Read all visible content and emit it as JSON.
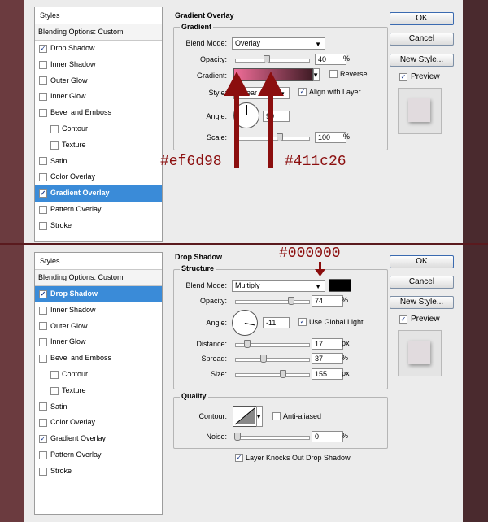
{
  "style_list": {
    "header": "Styles",
    "blending": "Blending Options: Custom",
    "items": [
      {
        "label": "Drop Shadow",
        "checked": true
      },
      {
        "label": "Inner Shadow",
        "checked": false
      },
      {
        "label": "Outer Glow",
        "checked": false
      },
      {
        "label": "Inner Glow",
        "checked": false
      },
      {
        "label": "Bevel and Emboss",
        "checked": false
      },
      {
        "label": "Contour",
        "checked": false,
        "sub": true
      },
      {
        "label": "Texture",
        "checked": false,
        "sub": true
      },
      {
        "label": "Satin",
        "checked": false
      },
      {
        "label": "Color Overlay",
        "checked": false
      },
      {
        "label": "Gradient Overlay",
        "checked": true
      },
      {
        "label": "Pattern Overlay",
        "checked": false
      },
      {
        "label": "Stroke",
        "checked": false
      }
    ],
    "check_glyph": "✓"
  },
  "buttons": {
    "ok": "OK",
    "cancel": "Cancel",
    "new_style": "New Style...",
    "preview": "Preview"
  },
  "gradient_overlay": {
    "title": "Gradient Overlay",
    "group": "Gradient",
    "blend_mode_label": "Blend Mode:",
    "blend_mode": "Overlay",
    "opacity_label": "Opacity:",
    "opacity": "40",
    "opacity_unit": "%",
    "gradient_label": "Gradient:",
    "gradient_colors": [
      "#ef6d98",
      "#411c26"
    ],
    "reverse_label": "Reverse",
    "style_label": "Style:",
    "style": "Linear",
    "align_label": "Align with Layer",
    "angle_label": "Angle:",
    "angle": "90",
    "scale_label": "Scale:",
    "scale": "100",
    "scale_unit": "%",
    "annot_left": "#ef6d98",
    "annot_right": "#411c26"
  },
  "drop_shadow": {
    "title": "Drop Shadow",
    "group": "Structure",
    "blend_mode_label": "Blend Mode:",
    "blend_mode": "Multiply",
    "opacity_label": "Opacity:",
    "opacity": "74",
    "angle_label": "Angle:",
    "angle": "-11",
    "global_light_label": "Use Global Light",
    "distance_label": "Distance:",
    "distance": "17",
    "spread_label": "Spread:",
    "spread": "37",
    "size_label": "Size:",
    "size": "155",
    "pct": "%",
    "px": "px",
    "quality_group": "Quality",
    "contour_label": "Contour:",
    "antialias_label": "Anti-aliased",
    "noise_label": "Noise:",
    "noise": "0",
    "knockout_label": "Layer Knocks Out Drop Shadow",
    "shadow_color": "#000000",
    "annot_color": "#000000"
  }
}
